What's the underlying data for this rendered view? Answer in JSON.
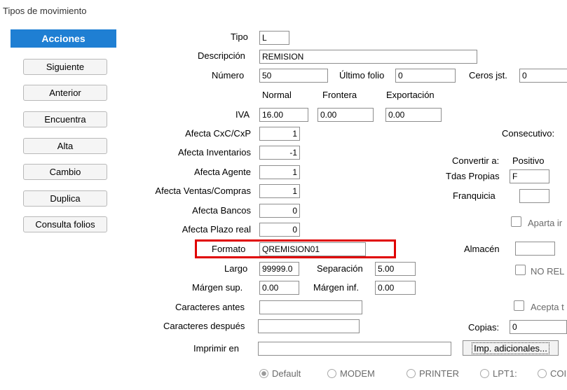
{
  "window": {
    "title": "Tipos de movimiento"
  },
  "sidebar": {
    "header": "Acciones",
    "buttons": [
      "Siguiente",
      "Anterior",
      "Encuentra",
      "Alta",
      "Cambio",
      "Duplica",
      "Consulta folios"
    ]
  },
  "form": {
    "tipo": {
      "label": "Tipo",
      "value": "L"
    },
    "descripcion": {
      "label": "Descripción",
      "value": "REMISION"
    },
    "numero": {
      "label": "Número",
      "value": "50"
    },
    "ultimo_folio": {
      "label": "Último folio",
      "value": "0"
    },
    "ceros": {
      "label": "Ceros jst.",
      "value": "0"
    },
    "col_headers": [
      "Normal",
      "Frontera",
      "Exportación"
    ],
    "iva": {
      "label": "IVA",
      "normal": "16.00",
      "frontera": "0.00",
      "exportacion": "0.00"
    },
    "afecta_cxc": {
      "label": "Afecta CxC/CxP",
      "value": "1"
    },
    "afecta_inv": {
      "label": "Afecta Inventarios",
      "value": "-1"
    },
    "afecta_agente": {
      "label": "Afecta Agente",
      "value": "1"
    },
    "afecta_ventas": {
      "label": "Afecta Ventas/Compras",
      "value": "1"
    },
    "afecta_bancos": {
      "label": "Afecta Bancos",
      "value": "0"
    },
    "afecta_plazo": {
      "label": "Afecta Plazo real",
      "value": "0"
    },
    "formato": {
      "label": "Formato",
      "value": "QREMISION01"
    },
    "largo": {
      "label": "Largo",
      "value": "99999.0"
    },
    "separacion": {
      "label": "Separación",
      "value": "5.00"
    },
    "margen_sup": {
      "label": "Márgen sup.",
      "value": "0.00"
    },
    "margen_inf": {
      "label": "Márgen inf.",
      "value": "0.00"
    },
    "car_antes": {
      "label": "Caracteres antes",
      "value": ""
    },
    "car_despues": {
      "label": "Caracteres después",
      "value": ""
    },
    "imprimir_en": {
      "label": "Imprimir en",
      "value": ""
    },
    "copias": {
      "label": "Copias:",
      "value": "0"
    },
    "imp_adicionales": "Imp. adicionales..."
  },
  "right": {
    "consecutivo": "Consecutivo:",
    "convertir_a": "Convertir a:",
    "convertir_val": "Positivo",
    "tdas_propias": {
      "label": "Tdas Propias",
      "value": "F"
    },
    "franquicia": {
      "label": "Franquicia",
      "value": ""
    },
    "aparta": "Aparta ir",
    "almacen": {
      "label": "Almacén",
      "value": ""
    },
    "no_rel": "NO REL",
    "acepta": "Acepta t"
  },
  "radios": [
    "Default",
    "MODEM",
    "PRINTER",
    "LPT1:",
    "COI"
  ]
}
